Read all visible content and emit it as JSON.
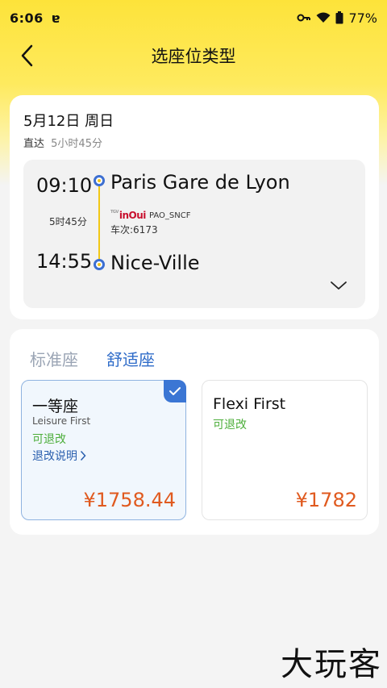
{
  "status_bar": {
    "time": "6:06",
    "left_icon": "ɐ",
    "battery": "77%"
  },
  "nav": {
    "title": "选座位类型"
  },
  "trip": {
    "date": "5月12日 周日",
    "direct_label": "直达",
    "total_duration": "5小时45分",
    "departure_time": "09:10",
    "departure_station": "Paris Gare de Lyon",
    "segment_duration": "5时45分",
    "brand": "inOui",
    "brand_prefix": "TGV",
    "operator_code": "PAO_SNCF",
    "train_number": "车次:6173",
    "arrival_time": "14:55",
    "arrival_station": "Nice-Ville"
  },
  "seat_tabs": [
    {
      "label": "标准座",
      "active": false
    },
    {
      "label": "舒适座",
      "active": true
    }
  ],
  "options": [
    {
      "name": "一等座",
      "english": "Leisure First",
      "refund": "可退改",
      "rule_link": "退改说明",
      "price": "¥1758.44",
      "selected": true
    },
    {
      "name": "Flexi First",
      "refund": "可退改",
      "price": "¥1782",
      "selected": false
    }
  ],
  "watermark": "大玩客",
  "colors": {
    "accent_blue": "#2f6cc9",
    "price_orange": "#e05a1f",
    "refund_green": "#4cae3a",
    "header_yellow": "#fde33a"
  },
  "icons": {
    "back": "back-arrow-icon",
    "key": "key-icon",
    "wifi": "wifi-icon",
    "battery": "battery-icon",
    "expand": "chevron-down-icon",
    "check": "check-icon"
  }
}
